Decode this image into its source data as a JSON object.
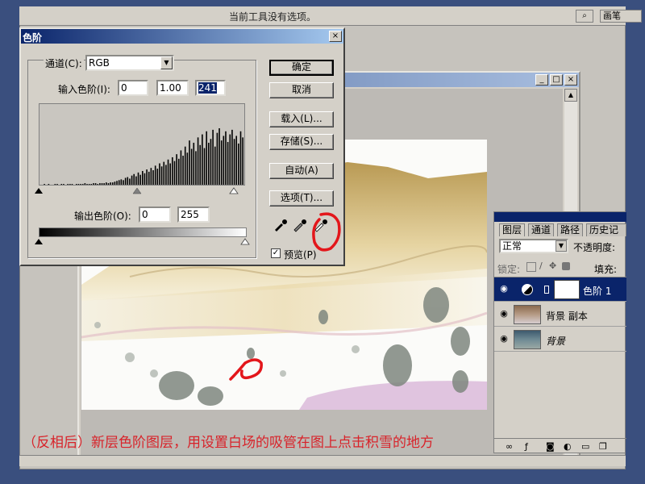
{
  "topbar": {
    "hint": "当前工具没有选项。",
    "brush_tab": "画笔"
  },
  "levels": {
    "title": "色阶",
    "channel_label": "通道(C):",
    "channel_value": "RGB",
    "input_label": "输入色阶(I):",
    "input_values": [
      "0",
      "1.00",
      "241"
    ],
    "output_label": "输出色阶(O):",
    "output_values": [
      "0",
      "255"
    ],
    "buttons": {
      "ok": "确定",
      "cancel": "取消",
      "load": "载入(L)...",
      "save": "存储(S)...",
      "auto": "自动(A)",
      "options": "选项(T)..."
    },
    "preview_label": "预览(P)",
    "preview_checked": true,
    "histogram_bars": [
      0,
      0,
      1,
      0,
      1,
      0,
      0,
      1,
      1,
      0,
      1,
      1,
      0,
      1,
      1,
      1,
      0,
      1,
      1,
      1,
      1,
      2,
      1,
      1,
      1,
      2,
      2,
      1,
      2,
      2,
      2,
      3,
      2,
      3,
      3,
      4,
      5,
      6,
      7,
      6,
      9,
      10,
      8,
      12,
      14,
      11,
      16,
      13,
      18,
      15,
      20,
      17,
      22,
      19,
      25,
      21,
      28,
      24,
      30,
      26,
      33,
      28,
      36,
      31,
      40,
      34,
      45,
      38,
      50,
      42,
      58,
      47,
      55,
      44,
      62,
      52,
      66,
      48,
      70,
      55,
      60,
      72,
      50,
      68,
      74,
      58,
      64,
      70,
      56,
      66,
      72,
      60,
      64,
      54,
      70,
      62
    ]
  },
  "layers": {
    "tabs": [
      "图层",
      "通道",
      "路径",
      "历史记录"
    ],
    "blend_mode": "正常",
    "opacity_label": "不透明度:",
    "lock_label": "锁定:",
    "fill_label": "填充:",
    "items": [
      {
        "name": "色阶 1",
        "active": true
      },
      {
        "name": "背景 副本",
        "active": false
      },
      {
        "name": "背景",
        "active": false
      }
    ]
  },
  "caption": "（反相后）新层色阶图层，用设置白场的吸管在图上点击积雪的地方",
  "colors": {
    "annotation": "#e3161b",
    "titlebar": "#0a246a"
  }
}
